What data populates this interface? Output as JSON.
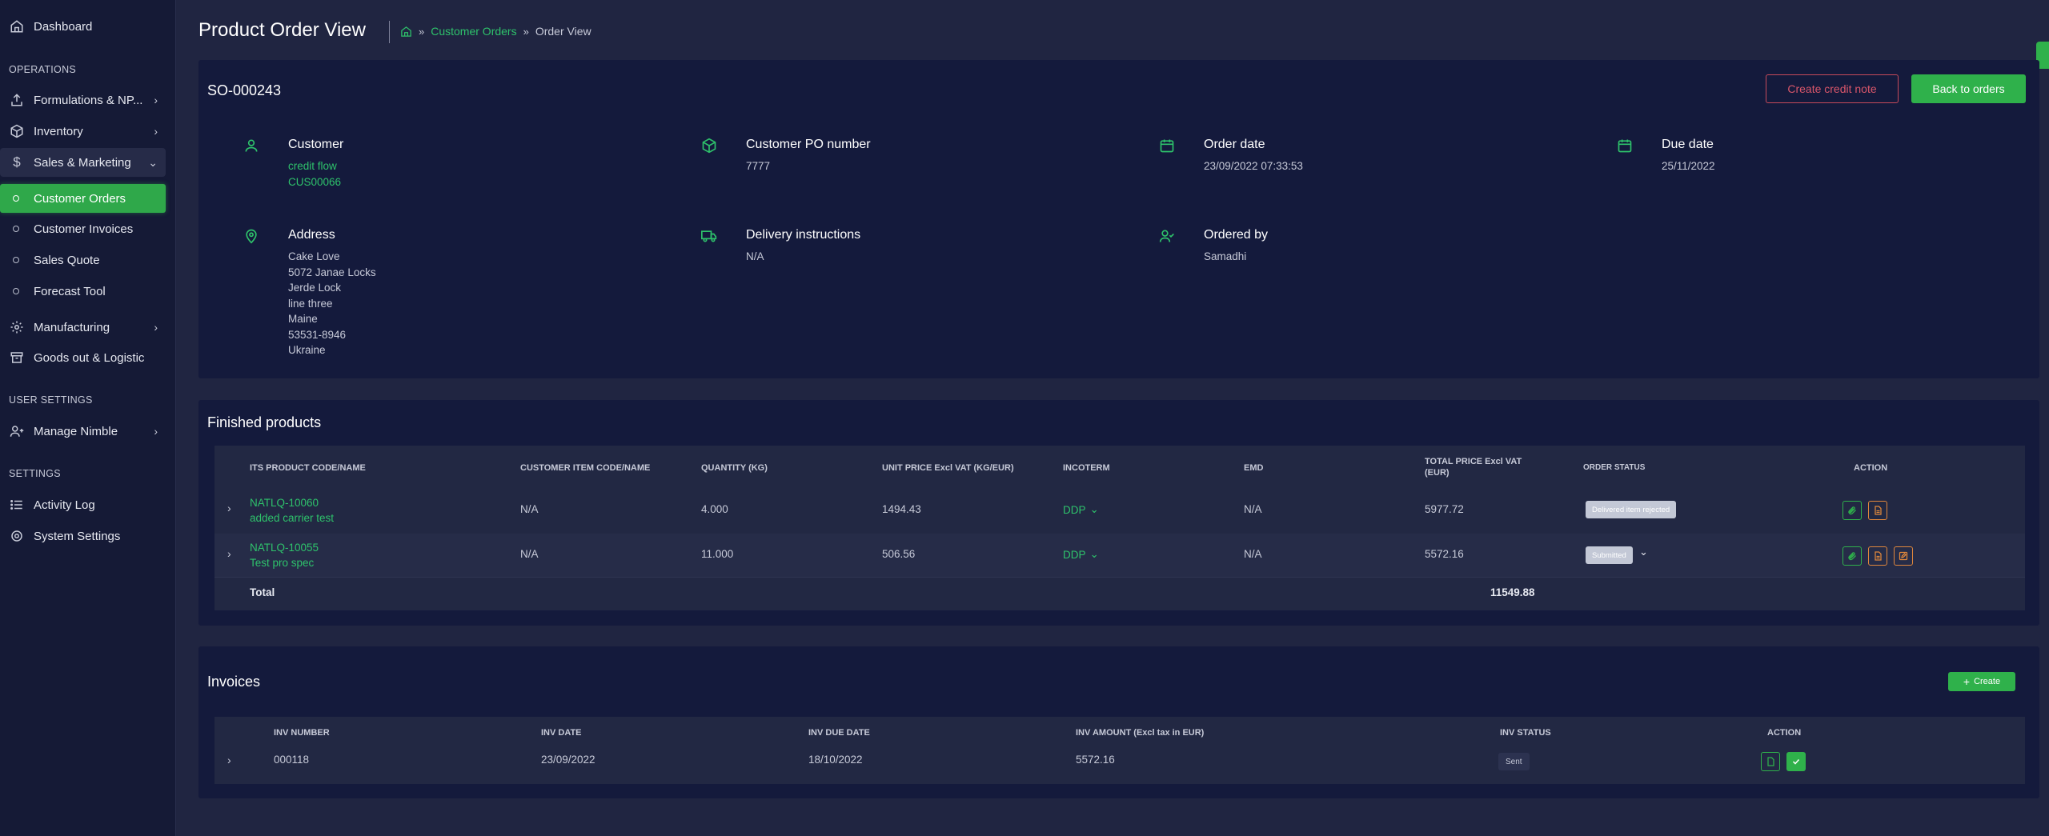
{
  "sidebar": {
    "dashboard": "Dashboard",
    "section_operations": "OPERATIONS",
    "formulations": "Formulations & NP...",
    "inventory": "Inventory",
    "sales_marketing": "Sales & Marketing",
    "customer_orders": "Customer Orders",
    "customer_invoices": "Customer Invoices",
    "sales_quote": "Sales Quote",
    "forecast_tool": "Forecast Tool",
    "manufacturing": "Manufacturing",
    "goods_out": "Goods out & Logistic",
    "section_user_settings": "USER SETTINGS",
    "manage_nimble": "Manage Nimble",
    "section_settings": "SETTINGS",
    "activity_log": "Activity Log",
    "system_settings": "System Settings"
  },
  "header": {
    "title": "Product Order View",
    "breadcrumb_link": "Customer Orders",
    "breadcrumb_current": "Order View",
    "separator": "»"
  },
  "order": {
    "number": "SO-000243",
    "create_credit_note": "Create credit note",
    "back_to_orders": "Back to orders",
    "customer_label": "Customer",
    "customer_name": "credit flow",
    "customer_code": "CUS00066",
    "po_label": "Customer PO number",
    "po_value": "7777",
    "order_date_label": "Order date",
    "order_date_value": "23/09/2022 07:33:53",
    "due_date_label": "Due date",
    "due_date_value": "25/11/2022",
    "address_label": "Address",
    "address_lines": [
      "Cake Love",
      "5072 Janae Locks",
      "Jerde Lock",
      "line three",
      "Maine",
      "53531-8946",
      "Ukraine"
    ],
    "delivery_label": "Delivery instructions",
    "delivery_value": "N/A",
    "ordered_by_label": "Ordered by",
    "ordered_by_value": "Samadhi"
  },
  "finished_products": {
    "title": "Finished products",
    "headers": {
      "product": "ITS PRODUCT CODE/NAME",
      "customer_item": "CUSTOMER ITEM CODE/NAME",
      "quantity": "QUANTITY (KG)",
      "unit_price": "UNIT PRICE Excl VAT (KG/EUR)",
      "incoterm": "INCOTERM",
      "emd": "EMD",
      "total_price_1": "TOTAL PRICE Excl VAT",
      "total_price_2": "(EUR)",
      "order_status": "ORDER STATUS",
      "action": "ACTION"
    },
    "rows": [
      {
        "code": "NATLQ-10060",
        "name": "added carrier test",
        "customer_item": "N/A",
        "quantity": "4.000",
        "unit_price": "1494.43",
        "incoterm": "DDP",
        "emd": "N/A",
        "total": "5977.72",
        "status": "Delivered item rejected"
      },
      {
        "code": "NATLQ-10055",
        "name": "Test pro spec",
        "customer_item": "N/A",
        "quantity": "11.000",
        "unit_price": "506.56",
        "incoterm": "DDP",
        "emd": "N/A",
        "total": "5572.16",
        "status": "Submitted"
      }
    ],
    "total_label": "Total",
    "total_value": "11549.88"
  },
  "invoices": {
    "title": "Invoices",
    "create_label": "Create",
    "headers": {
      "number": "INV NUMBER",
      "date": "INV DATE",
      "due_date": "INV DUE DATE",
      "amount": "INV AMOUNT (Excl tax in EUR)",
      "status": "INV STATUS",
      "action": "ACTION"
    },
    "rows": [
      {
        "number": "000118",
        "date": "23/09/2022",
        "due_date": "18/10/2022",
        "amount": "5572.16",
        "status": "Sent"
      }
    ]
  },
  "colors": {
    "accent_green": "#2fb14b",
    "link_green": "#2ec26b",
    "danger": "#d9566a",
    "warning": "#e0873c",
    "background": "#202541",
    "panel": "#141a3c",
    "sidebar": "#151a36"
  }
}
